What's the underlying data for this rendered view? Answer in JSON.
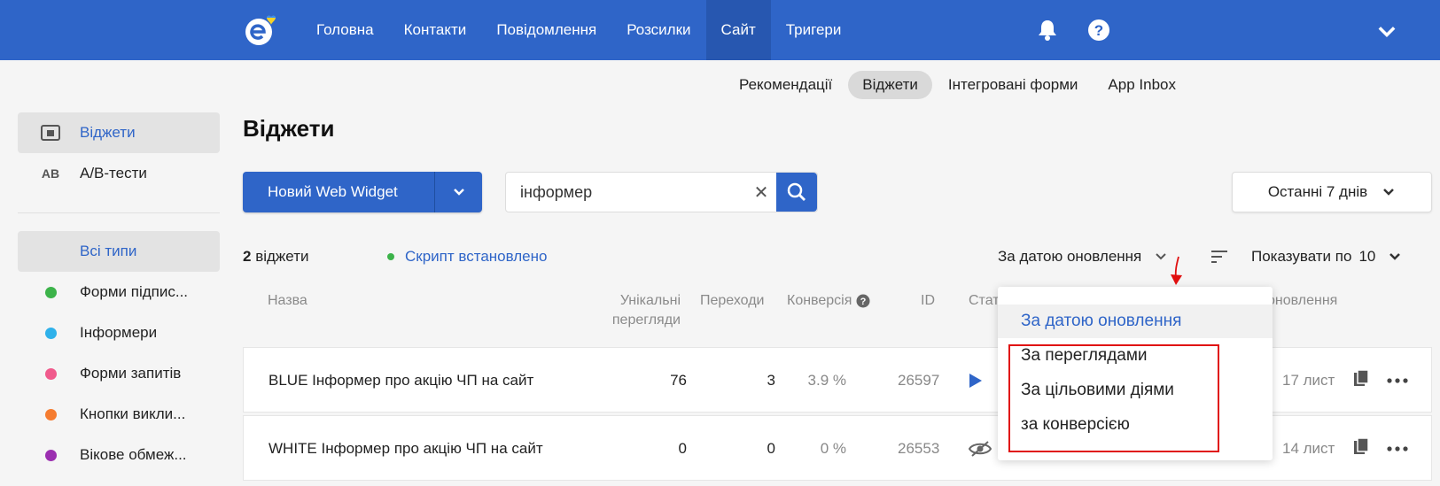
{
  "nav": {
    "items": [
      {
        "label": "Головна"
      },
      {
        "label": "Контакти"
      },
      {
        "label": "Повідомлення"
      },
      {
        "label": "Розсилки"
      },
      {
        "label": "Сайт"
      },
      {
        "label": "Тригери"
      }
    ],
    "active_index": 4
  },
  "subnav": {
    "items": [
      {
        "label": "Рекомендації"
      },
      {
        "label": "Віджети"
      },
      {
        "label": "Інтегровані форми"
      },
      {
        "label": "App Inbox"
      }
    ],
    "active_index": 1
  },
  "sidebar": {
    "top": [
      {
        "label": "Віджети",
        "icon": "widget-icon",
        "active": true
      },
      {
        "label": "A/B-тести",
        "icon": "ab-icon",
        "icon_text": "AB"
      }
    ],
    "types": [
      {
        "label": "Всі типи",
        "color": "#e3e3e3",
        "active": true
      },
      {
        "label": "Форми підпис...",
        "color": "#3cb34a"
      },
      {
        "label": "Інформери",
        "color": "#2fb1ea"
      },
      {
        "label": "Форми запитів",
        "color": "#f05a8c"
      },
      {
        "label": "Кнопки викли...",
        "color": "#f57c30"
      },
      {
        "label": "Вікове обмеж...",
        "color": "#9b2fb0"
      }
    ]
  },
  "main": {
    "title": "Віджети",
    "new_button_label": "Новий Web Widget",
    "search_value": "інформер",
    "period_label": "Останні 7 днів",
    "count_number": "2",
    "count_suffix": "віджети",
    "script_status": "Скрипт встановлено",
    "sort_label": "За датою оновлення",
    "perpage_label": "Показувати по",
    "perpage_value": "10"
  },
  "table": {
    "headers": {
      "name": "Назва",
      "unique_views_1": "Унікальні",
      "unique_views_2": "перегляди",
      "clicks": "Переходи",
      "conversion": "Конверсія",
      "id": "ID",
      "status": "Стат",
      "updated": "оновлення"
    },
    "rows": [
      {
        "name": "BLUE Інформер про акцію ЧП на сайт",
        "views": "76",
        "clicks": "3",
        "conversion": "3.9 %",
        "id": "26597",
        "status_icon": "play-icon",
        "updated": "17 лист"
      },
      {
        "name": "WHITE Інформер про акцію ЧП на сайт",
        "views": "0",
        "clicks": "0",
        "conversion": "0 %",
        "id": "26553",
        "status_icon": "hidden-eye-icon",
        "updated": "14 лист"
      }
    ]
  },
  "dropdown": {
    "options": [
      {
        "label": "За датою оновлення",
        "selected": true
      },
      {
        "label": "За переглядами"
      },
      {
        "label": "За цільовими діями"
      },
      {
        "label": "за конверсією"
      }
    ]
  },
  "colors": {
    "brand_blue": "#2f65c8",
    "annotation_red": "#e01010"
  }
}
